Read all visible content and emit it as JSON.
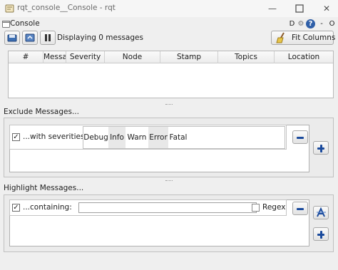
{
  "window": {
    "title": "rqt_console__Console - rqt",
    "controls": {
      "restore": "D",
      "close": "O"
    }
  },
  "plugin": {
    "title": "Console",
    "header_buttons": {
      "dock": "D",
      "settings": "⚙",
      "help": "?",
      "close": "O"
    }
  },
  "toolbar": {
    "display_label": "Displaying 0 messages",
    "fit_columns_label": "Fit Columns"
  },
  "message_table": {
    "columns": [
      "#",
      "Message",
      "Severity",
      "Node",
      "Stamp",
      "Topics",
      "Location"
    ]
  },
  "exclude": {
    "title": "Exclude Messages...",
    "row_label": "...with severities:",
    "checked": true,
    "severities": [
      "Debug",
      "Info",
      "Warn",
      "Error",
      "Fatal"
    ]
  },
  "highlight": {
    "title": "Highlight Messages...",
    "row_label": "...containing:",
    "checked": true,
    "text_value": "",
    "regex_label": "Regex",
    "regex_checked": false
  },
  "colors": {
    "background": "#efefef",
    "accent_blue": "#1a4a9c"
  },
  "icons": {
    "app": "rqt-app-icon",
    "pause": "pause-icon",
    "save": "save-icon",
    "load": "load-icon",
    "fit_columns": "broom-icon",
    "remove_filter": "minus-icon",
    "add_filter": "plus-icon",
    "highlight_filter": "highlight-icon"
  }
}
